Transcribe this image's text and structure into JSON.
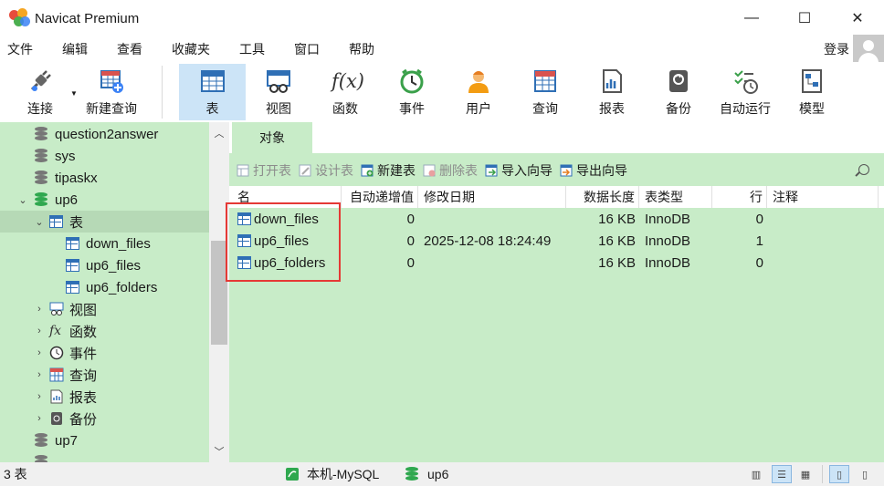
{
  "window": {
    "title": "Navicat Premium",
    "controls": {
      "minimize": "—",
      "maximize": "☐",
      "close": "✕"
    }
  },
  "menu": {
    "items": [
      "文件",
      "编辑",
      "查看",
      "收藏夹",
      "工具",
      "窗口",
      "帮助"
    ],
    "login": "登录"
  },
  "toolbar": {
    "buttons": [
      {
        "label": "连接",
        "icon": "plug-icon"
      },
      {
        "label": "新建查询",
        "icon": "new-query-icon"
      },
      {
        "label": "表",
        "icon": "table-icon",
        "active": true
      },
      {
        "label": "视图",
        "icon": "view-icon"
      },
      {
        "label": "函数",
        "icon": "function-icon"
      },
      {
        "label": "事件",
        "icon": "clock-icon"
      },
      {
        "label": "用户",
        "icon": "user-icon"
      },
      {
        "label": "查询",
        "icon": "query-icon"
      },
      {
        "label": "报表",
        "icon": "report-icon"
      },
      {
        "label": "备份",
        "icon": "backup-icon"
      },
      {
        "label": "自动运行",
        "icon": "schedule-icon"
      },
      {
        "label": "模型",
        "icon": "model-icon"
      }
    ],
    "fx_glyph": "f(x)"
  },
  "tree": {
    "db_question2answer": "question2answer",
    "db_sys": "sys",
    "db_tipaskx": "tipaskx",
    "db_up6": "up6",
    "node_tables": "表",
    "table_down_files": "down_files",
    "table_up6_files": "up6_files",
    "table_up6_folders": "up6_folders",
    "node_views": "视图",
    "node_functions": "函数",
    "node_events": "事件",
    "node_queries": "查询",
    "node_reports": "报表",
    "node_backups": "备份",
    "db_up7": "up7",
    "fx_glyph": "fx"
  },
  "objects": {
    "tab_label": "对象",
    "actions": {
      "open_table": "打开表",
      "design_table": "设计表",
      "new_table": "新建表",
      "delete_table": "删除表",
      "import_wizard": "导入向导",
      "export_wizard": "导出向导"
    },
    "columns": {
      "name": "名",
      "auto_increment": "自动递增值",
      "modified": "修改日期",
      "data_length": "数据长度",
      "type": "表类型",
      "rows": "行",
      "comment": "注释"
    },
    "rows": [
      {
        "name": "down_files",
        "auto_increment": "0",
        "modified": "",
        "data_length": "16 KB",
        "type": "InnoDB",
        "rows": "0",
        "comment": ""
      },
      {
        "name": "up6_files",
        "auto_increment": "0",
        "modified": "2025-12-08 18:24:49",
        "data_length": "16 KB",
        "type": "InnoDB",
        "rows": "1",
        "comment": ""
      },
      {
        "name": "up6_folders",
        "auto_increment": "0",
        "modified": "",
        "data_length": "16 KB",
        "type": "InnoDB",
        "rows": "0",
        "comment": ""
      }
    ]
  },
  "status": {
    "count": "3 表",
    "connection": "本机-MySQL",
    "database": "up6"
  },
  "colors": {
    "tree_bg": "#c8ecc8",
    "selected_bg": "#b6d9b6",
    "active_tool": "#cce4f7",
    "highlight": "#e53935",
    "table_icon": "#2f6fb5"
  }
}
